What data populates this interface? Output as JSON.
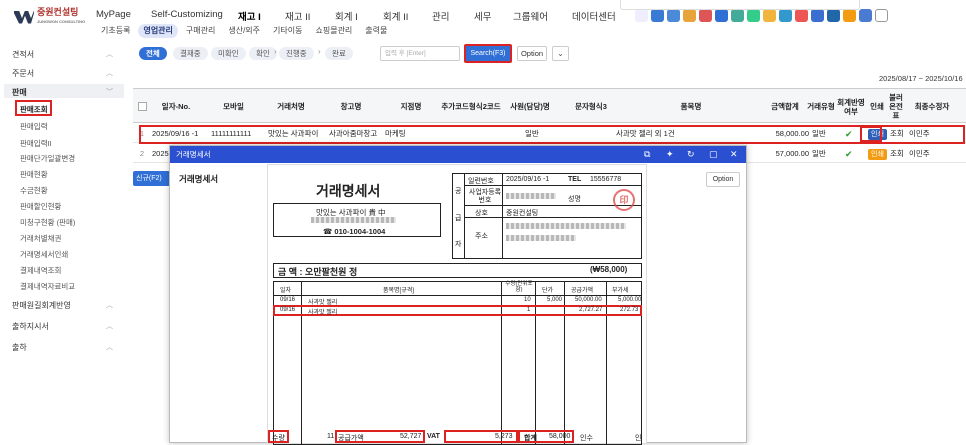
{
  "logo": {
    "text": "중원컨설팅",
    "sub": "JUNGWON CONSULTING"
  },
  "topmenu": [
    "MyPage",
    "Self-Customizing",
    "재고 I",
    "재고 II",
    "회계 I",
    "회계 II",
    "관리",
    "세무",
    "그룹웨어",
    "데이터센터"
  ],
  "topmenu_active": "재고 I",
  "subnav": [
    "기초등록",
    "영업관리",
    "구매관리",
    "생산/외주",
    "기타이동",
    "쇼핑몰관리",
    "출력물"
  ],
  "subnav_active": "영업관리",
  "sidebar": {
    "sections": [
      {
        "label": "견적서"
      },
      {
        "label": "주문서"
      },
      {
        "label": "판매"
      }
    ],
    "sub_items": [
      "판매조회",
      "판매입력",
      "판매입력II",
      "판매단가일괄변경",
      "판매현황",
      "수금현황",
      "판매할인현황",
      "미청구현황 (판매)",
      "거래처별채권",
      "거래명세서인쇄",
      "결제내역조회",
      "결제내역자료비교"
    ],
    "bottom": [
      "판매원길회계반영",
      "출하지시서",
      "출하"
    ]
  },
  "filters": {
    "tabs": [
      "전체",
      "결재중",
      "미확인",
      "확인",
      "진행중",
      "완료"
    ],
    "search_placeholder": "입력 후 [Enter]",
    "search_label": "Search(F3)",
    "option_label": "Option",
    "dropdown": "⌄"
  },
  "date_range": "2025/08/17 ~ 2025/10/16",
  "table": {
    "headers": [
      "일자-No.",
      "모바일",
      "거래처명",
      "창고명",
      "지점명",
      "추가코드형식2코드",
      "사원(담당)명",
      "문자형식3",
      "품목명",
      "금액합계",
      "거래유형",
      "회계반영여부",
      "인쇄",
      "불러온전표",
      "최종수정자"
    ],
    "rows": [
      {
        "num": "1",
        "date": "2025/09/16 -1",
        "mobile": "11111111111",
        "customer": "맛있는 사과파이",
        "warehouse": "사과아줌마창고",
        "branch": "마케팅",
        "employee": "일반",
        "item": "사과맛 젤리 외 1건",
        "total": "58,000.00",
        "type": "일반",
        "print": "인쇄",
        "view": "조회",
        "editor": "이민주"
      },
      {
        "num": "2",
        "date": "2025",
        "mobile": "",
        "customer": "",
        "warehouse": "",
        "branch": "",
        "employee": "",
        "item": "",
        "total": "57,000.00",
        "type": "일반",
        "print": "인쇄",
        "view": "조회",
        "editor": "이민주"
      }
    ]
  },
  "new_button": "신규(F2)",
  "modal": {
    "bar_title": "거래명세서",
    "title": "거래명세서",
    "option": "Option",
    "doc": {
      "heading": "거래명세서",
      "recipient": "맛있는 사과파이 貴 中",
      "phone": "☎ 010-1004-1004",
      "side_labels": [
        "공",
        "급",
        "자"
      ],
      "fields": {
        "serial_label": "일련번호",
        "serial": "2025/09/16 -1",
        "tel_label": "TEL",
        "tel": "15556778",
        "biz_label": "사업자등록번호",
        "name_label": "성명",
        "company_label": "상호",
        "company": "중원컨설팅",
        "addr_label": "주소"
      },
      "amount_text": "금    액 : 오만팔천원 정",
      "amount_num": "(₩58,000)",
      "cols": [
        "일자",
        "품목명[규격]",
        "수량(단위포함)",
        "단가",
        "공급가액",
        "부가세"
      ],
      "lines": [
        {
          "date": "09/16",
          "item": "사과맛 젤리",
          "qty": "10",
          "price": "5,000",
          "supply": "50,000.00",
          "vat": "5,000.00"
        },
        {
          "date": "09/16",
          "item": "사과맛 젤리",
          "qty": "1",
          "price": "",
          "supply": "2,727.27",
          "vat": "272.73"
        }
      ],
      "footer": {
        "qty_label": "수량",
        "qty": "11",
        "supply_label": "공급가액",
        "supply": "52,727",
        "vat_label": "VAT",
        "vat": "5,273",
        "total_label": "합계",
        "total": "58,000",
        "receiver_label": "인수",
        "receiver": "인"
      }
    }
  }
}
